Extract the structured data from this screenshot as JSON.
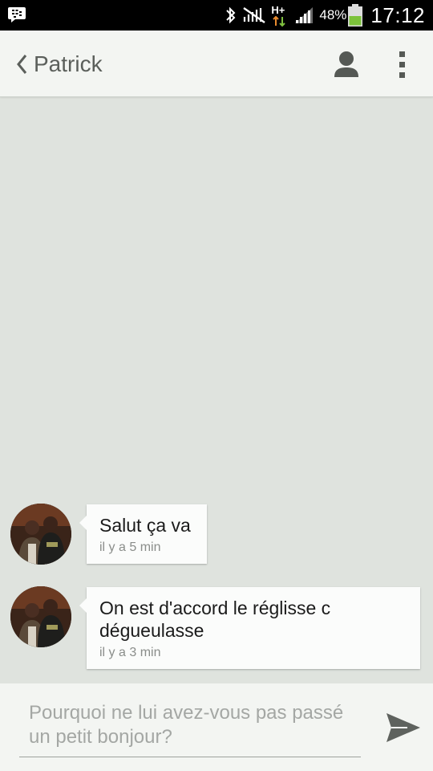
{
  "status_bar": {
    "network_label": "H+",
    "battery_percent": "48%",
    "time": "17:12",
    "icons": [
      "bbm-icon",
      "bluetooth-icon",
      "no-signal-icon",
      "h-plus-data-icon",
      "signal-icon",
      "battery-icon"
    ]
  },
  "app_bar": {
    "contact_name": "Patrick",
    "icons": [
      "back-chevron-icon",
      "contact-person-icon",
      "overflow-menu-icon"
    ]
  },
  "messages": [
    {
      "text": "Salut ça va",
      "time": "il y a 5 min"
    },
    {
      "text": "On est d'accord le réglisse c dégueulasse",
      "time": "il y a 3 min"
    }
  ],
  "composer": {
    "placeholder": "Pourquoi ne lui avez-vous pas passé un petit bonjour?",
    "send_icon": "send-icon"
  },
  "colors": {
    "background": "#dfe3de",
    "app_bar": "#f3f5f2",
    "bubble": "#fbfcfb",
    "send_icon": "#5e625e"
  }
}
